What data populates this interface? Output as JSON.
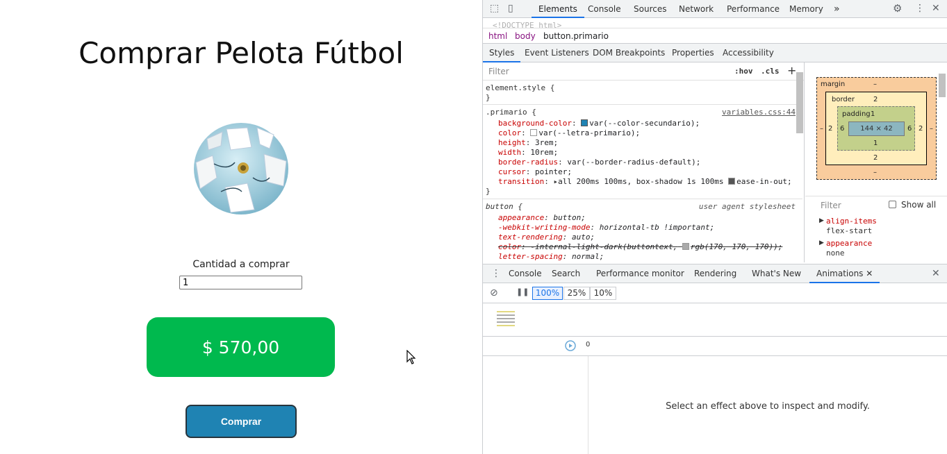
{
  "page": {
    "title": "Comprar Pelota Fútbol",
    "quantity_label": "Cantidad a comprar",
    "quantity_value": "1",
    "price": "$ 570,00",
    "buy_label": "Comprar",
    "colors": {
      "price_bg": "#00b94e",
      "buy_bg": "#1f83b3"
    }
  },
  "devtools": {
    "tabs": [
      "Elements",
      "Console",
      "Sources",
      "Network",
      "Performance",
      "Memory"
    ],
    "more_tabs": "»",
    "doctype": "<!DOCTYPE html>",
    "breadcrumbs": [
      "html",
      "body",
      "button.primario"
    ],
    "subtabs": [
      "Styles",
      "Event Listeners",
      "DOM Breakpoints",
      "Properties",
      "Accessibility"
    ],
    "filter_placeholder": "Filter",
    "hov": ":hov",
    "cls": ".cls",
    "add": "+",
    "element_style": "element.style {",
    "close_brace": "}",
    "rule1": {
      "selector": ".primario",
      "source": "variables.css:44",
      "props": [
        {
          "name": "background-color",
          "value": "var(--color-secundario);",
          "swatch": "#1f83b3"
        },
        {
          "name": "color",
          "value": "var(--letra-primario);",
          "swatch": "#ffffff"
        },
        {
          "name": "height",
          "value": "3rem;"
        },
        {
          "name": "width",
          "value": "10rem;"
        },
        {
          "name": "border-radius",
          "value": "var(--border-radius-default);"
        },
        {
          "name": "cursor",
          "value": "pointer;"
        },
        {
          "name": "transition",
          "value": "all 200ms 100ms, box-shadow 1s 100ms",
          "tail": "ease-in-out;"
        }
      ]
    },
    "rule2": {
      "selector": "button",
      "source": "user agent stylesheet",
      "props": [
        {
          "name": "appearance",
          "value": "button;"
        },
        {
          "name": "-webkit-writing-mode",
          "value": "horizontal-tb !important;"
        },
        {
          "name": "text-rendering",
          "value": "auto;"
        },
        {
          "name": "color",
          "value": "-internal-light-dark(buttontext,",
          "tail": "rgb(170, 170, 170));"
        },
        {
          "name": "letter-spacing",
          "value": "normal;"
        }
      ]
    },
    "boxmodel": {
      "margin": "margin",
      "margin_value": "–",
      "border": "border",
      "border_value": "2",
      "padding": "padding",
      "padding_value": "1",
      "content": "144 × 42",
      "side_padding": "6",
      "side_border": "2"
    },
    "computed": {
      "filter": "Filter",
      "show_all": "Show all",
      "items": [
        {
          "name": "align-items",
          "value": "flex-start"
        },
        {
          "name": "appearance",
          "value": "none"
        }
      ]
    },
    "drawer_tabs": [
      "Console",
      "Search",
      "Performance monitor",
      "Rendering",
      "What's New",
      "Animations"
    ],
    "speeds": [
      "100%",
      "25%",
      "10%"
    ],
    "timeline_zero": "0",
    "empty_message": "Select an effect above to inspect and modify."
  }
}
